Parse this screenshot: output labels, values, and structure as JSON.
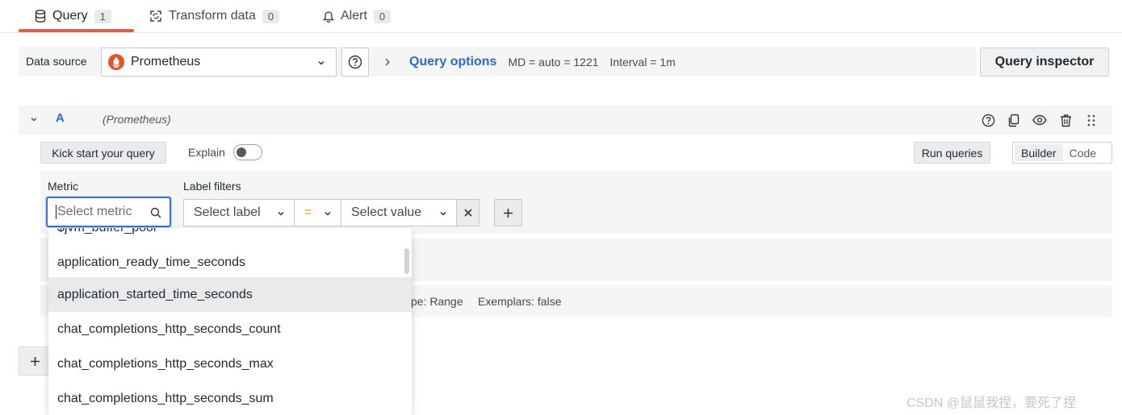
{
  "tabs": [
    {
      "label": "Query",
      "count": "1"
    },
    {
      "label": "Transform data",
      "count": "0"
    },
    {
      "label": "Alert",
      "count": "0"
    }
  ],
  "datasource": {
    "label": "Data source",
    "selected": "Prometheus",
    "query_options_label": "Query options",
    "md": "MD = auto = 1221",
    "interval": "Interval = 1m",
    "inspector_label": "Query inspector"
  },
  "query": {
    "ref": "A",
    "datasource": "(Prometheus)",
    "kick_start": "Kick start your query",
    "explain": "Explain",
    "run": "Run queries",
    "modes": [
      "Builder",
      "Code"
    ]
  },
  "builder": {
    "metric_label": "Metric",
    "label_filters_label": "Label filters",
    "metric_placeholder": "Select metric",
    "select_label": "Select label",
    "operator": "=",
    "select_value": "Select value"
  },
  "options_row": {
    "type": "pe: Range",
    "exemplars": "Exemplars: false"
  },
  "dropdown": {
    "partial_item": "$jvm_buffer_pool",
    "items": [
      "application_ready_time_seconds",
      "application_started_time_seconds",
      "chat_completions_http_seconds_count",
      "chat_completions_http_seconds_max",
      "chat_completions_http_seconds_sum"
    ],
    "highlighted_index": 1
  },
  "watermark": "CSDN @鼠鼠我捏，要死了捏",
  "colors": {
    "accent": "#2f68c7",
    "tab_active": "#ef5a3b",
    "focus": "#3871dc",
    "operator": "#e0a500"
  }
}
